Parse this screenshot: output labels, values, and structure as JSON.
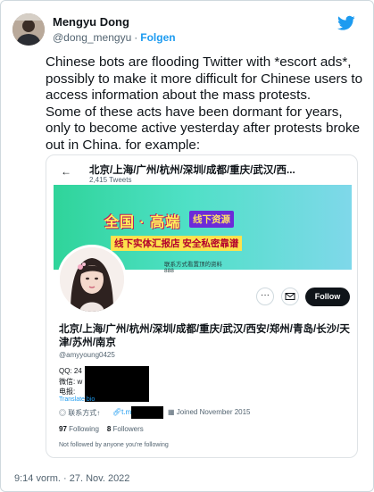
{
  "author": {
    "name": "Mengyu Dong",
    "handle": "@dong_mengyu",
    "separator": "·",
    "follow_label": "Folgen"
  },
  "tweet": {
    "text": "Chinese bots are flooding Twitter with *escort ads*, possibly to make it more difficult for Chinese users to access information about the mass protests.\nSome of these acts have been dormant for years, only to become active yesterday after protests broke out in China. for example:",
    "timestamp": "9:14 vorm. · 27. Nov. 2022"
  },
  "card": {
    "back_label": "←",
    "title": "北京/上海/广州/杭州/深圳/成都/重庆/武汉/西...",
    "tweet_count": "2,415 Tweets",
    "banner": {
      "main": "全国 · 高端",
      "badge": "线下资源",
      "sub": "线下实体汇报店  安全私密靠谱",
      "small": "联系方式看置顶的资料\n888"
    },
    "more_label": "···",
    "follow_button": "Follow",
    "display_name": "北京/上海/广州/杭州/深圳/成都/重庆/武汉/西安/郑州/青岛/长沙/天津/苏州/南京",
    "handle": "@amyyoung0425",
    "bio": {
      "line1": "QQ: 24",
      "line2": "微信: w",
      "line3": "电报: "
    },
    "bio_link": "Translate bio",
    "location": "联系方式↑",
    "link": "t.m",
    "joined": "Joined November 2015",
    "following_count": "97",
    "following_label": "Following",
    "followers_count": "8",
    "followers_label": "Followers",
    "note": "Not followed by anyone you're following"
  },
  "colors": {
    "accent": "#1d9bf0",
    "text": "#0f1419",
    "muted": "#536471"
  }
}
